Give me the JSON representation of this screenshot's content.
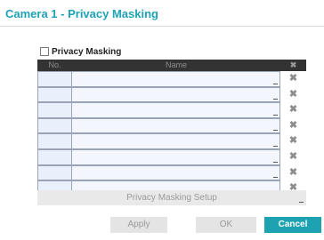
{
  "dialog": {
    "title": "Camera 1 - Privacy Masking",
    "privacy_masking_label": "Privacy Masking",
    "privacy_masking_checked": false,
    "accent_color": "#1da2b2"
  },
  "table": {
    "col_no": "No.",
    "col_name": "Name",
    "col_delete_icon": "✖",
    "rows": [
      {
        "no": "",
        "name": "",
        "delete_icon": "✖"
      },
      {
        "no": "",
        "name": "",
        "delete_icon": "✖"
      },
      {
        "no": "",
        "name": "",
        "delete_icon": "✖"
      },
      {
        "no": "",
        "name": "",
        "delete_icon": "✖"
      },
      {
        "no": "",
        "name": "",
        "delete_icon": "✖"
      },
      {
        "no": "",
        "name": "",
        "delete_icon": "✖"
      },
      {
        "no": "",
        "name": "",
        "delete_icon": "✖"
      },
      {
        "no": "",
        "name": "",
        "delete_icon": "✖"
      }
    ]
  },
  "setup": {
    "label": "Privacy Masking Setup"
  },
  "buttons": {
    "apply": "Apply",
    "ok": "OK",
    "cancel": "Cancel"
  }
}
